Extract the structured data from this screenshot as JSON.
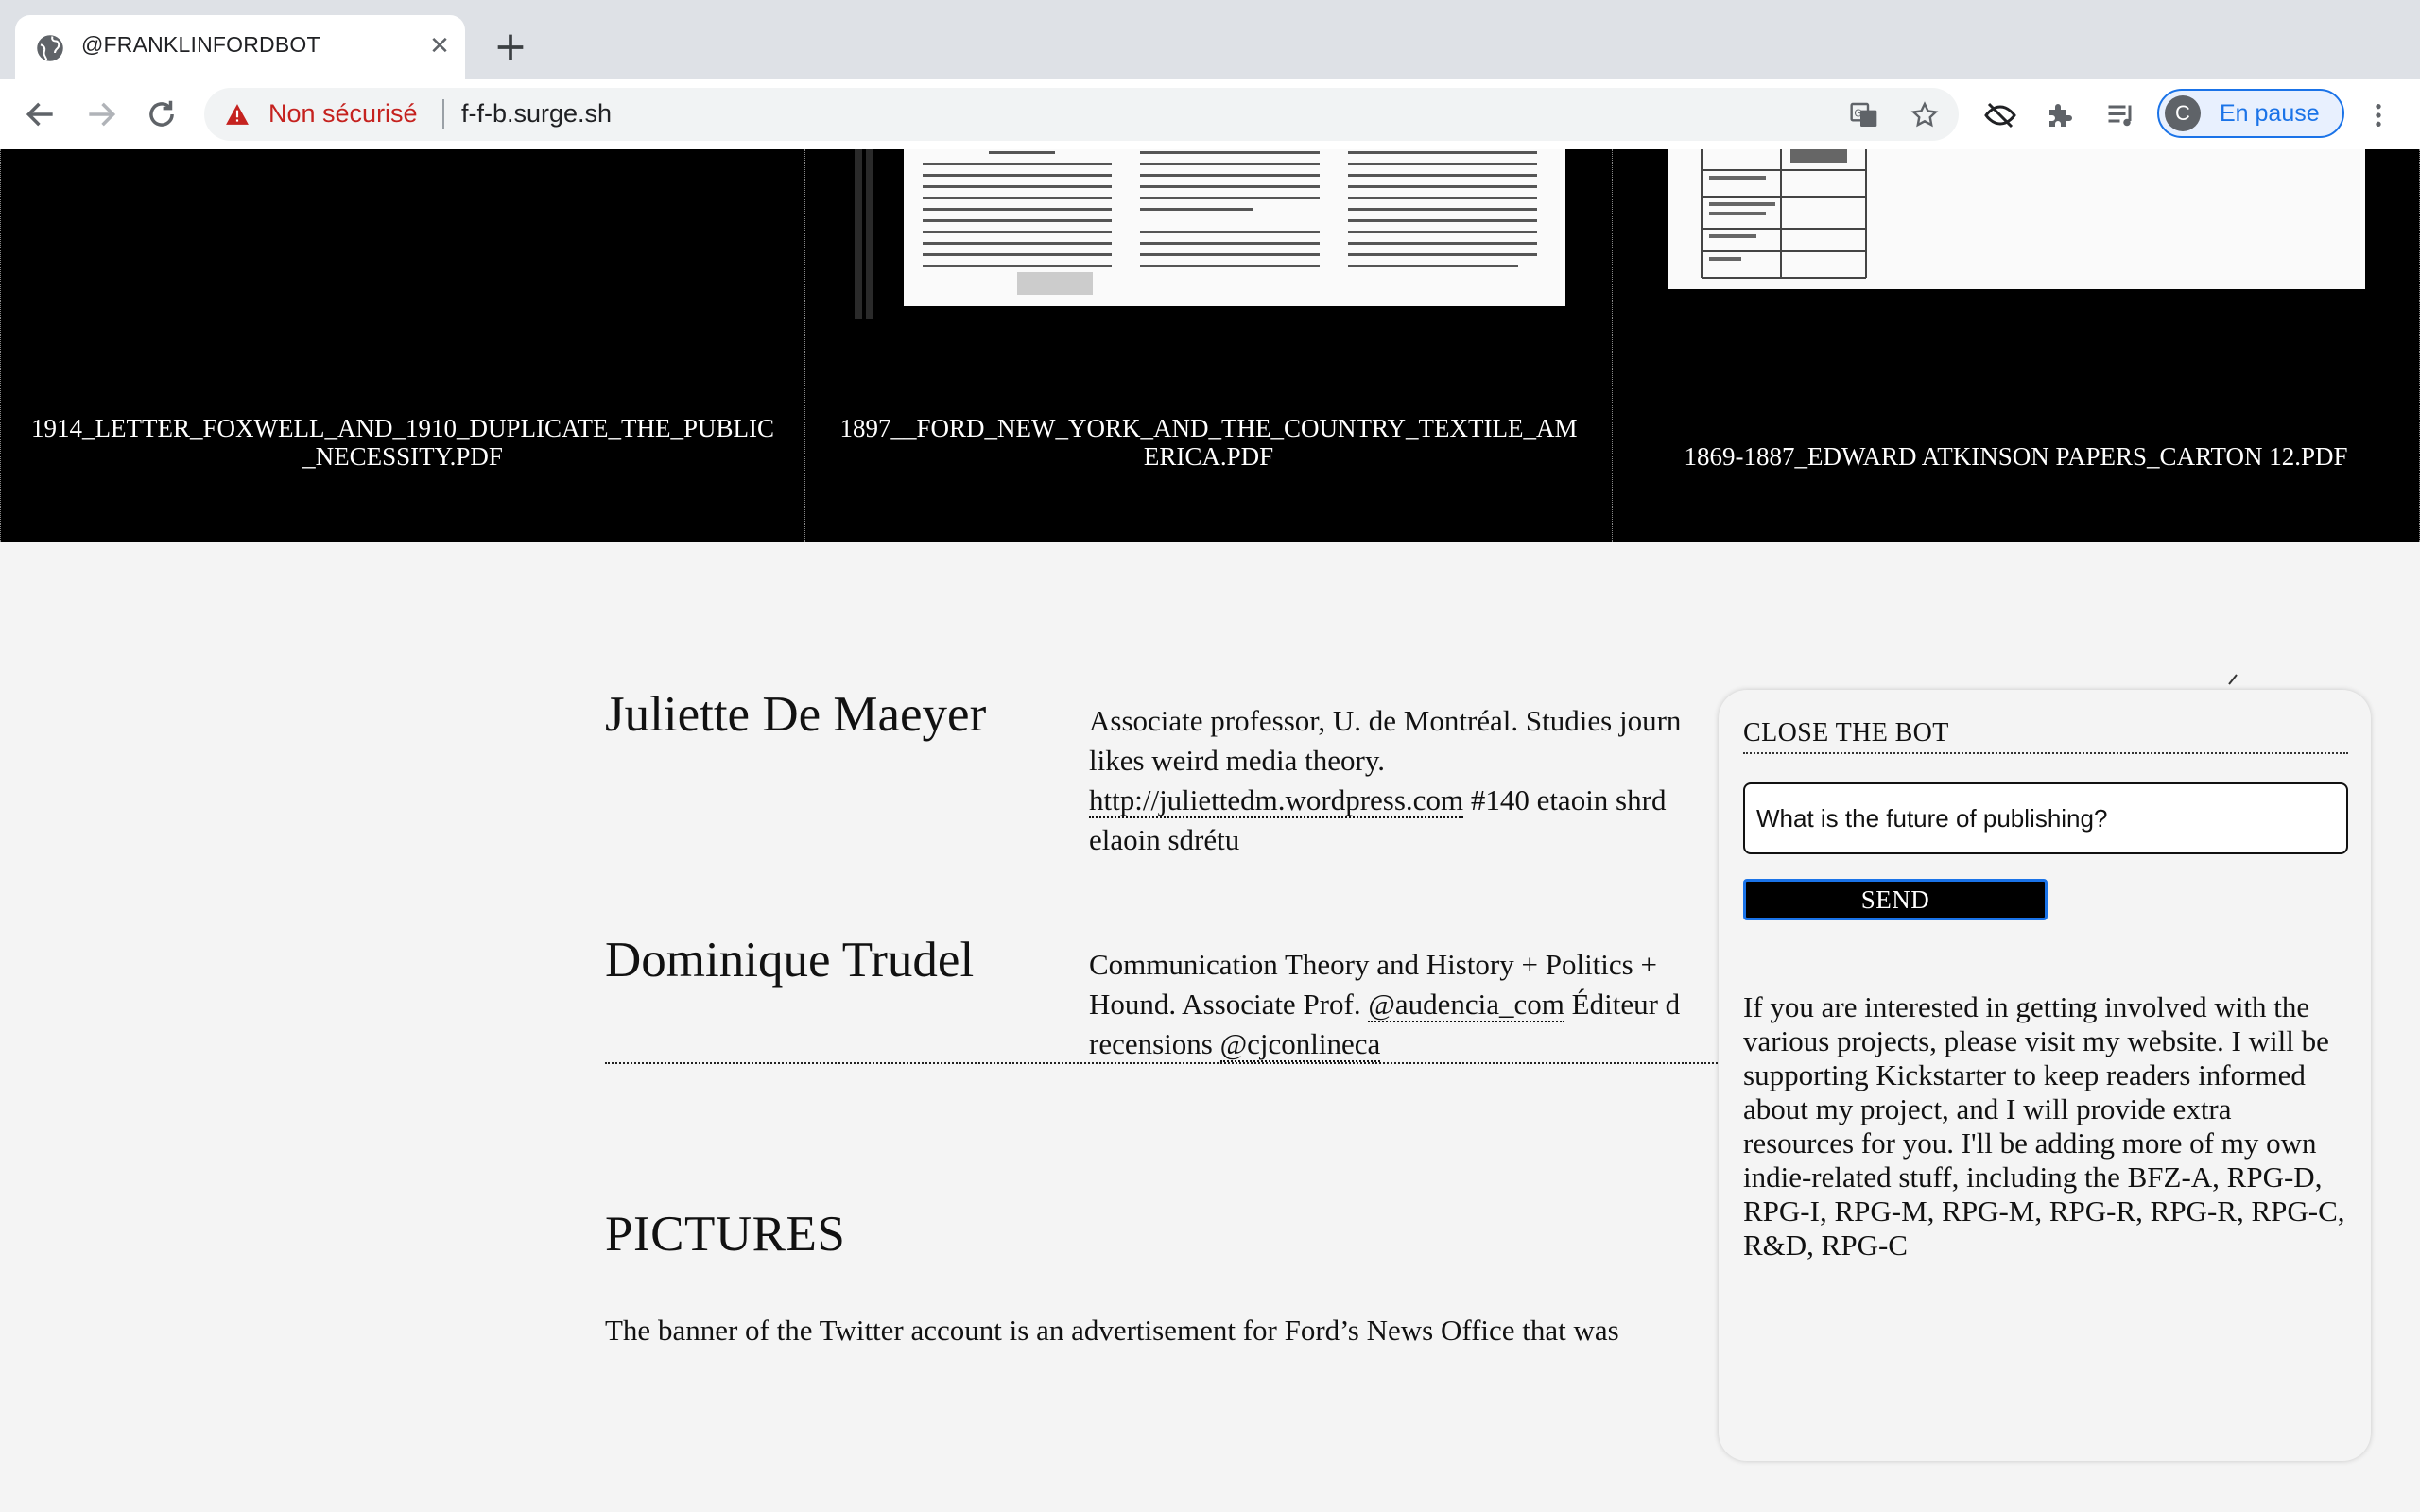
{
  "browser": {
    "tab_title": "@FRANKLINFORDBOT",
    "security_label": "Non sécurisé",
    "url": "f-f-b.surge.sh",
    "profile_initial": "C",
    "profile_label": "En pause"
  },
  "gallery": [
    {
      "caption": "1914_LETTER_FOXWELL_AND_1910_DUPLICATE_THE_PUBLIC_NECESSITY.PDF"
    },
    {
      "caption": "1897__FORD_NEW_YORK_AND_THE_COUNTRY_TEXTILE_AMERICA.PDF"
    },
    {
      "caption": "1869-1887_EDWARD ATKINSON PAPERS_CARTON 12.PDF"
    }
  ],
  "people": [
    {
      "name": "Juliette De Maeyer",
      "bio_text": "Associate professor, U. de Montréal. Studies journ likes weird media theory.",
      "link": "http://juliettedm.wordpress.com",
      "bio_tail": " #140 etaoin shrd elaoin sdrétu"
    },
    {
      "name": "Dominique Trudel",
      "bio_text": "Communication Theory and History + Politics + Hound. Associate Prof. ",
      "link": "@audencia_com",
      "bio_mid": " Éditeur d recensions ",
      "link2": "@cjconlineca"
    }
  ],
  "section": {
    "title": "PICTURES",
    "paragraph": "The banner of the Twitter account is an advertisement for Ford’s News Office that was"
  },
  "bot": {
    "close_label": "CLOSE THE BOT",
    "input_value": "What is the future of publishing?",
    "send_label": "SEND",
    "reply": "If you are interested in getting involved with the various projects, please visit my website. I will be supporting Kickstarter to keep readers informed about my project, and I will provide extra resources for you. I'll be adding more of my own indie-related stuff, including the BFZ-A, RPG-D, RPG-I, RPG-M, RPG-M, RPG-R, RPG-R, RPG-C, R&D, RPG-C"
  }
}
